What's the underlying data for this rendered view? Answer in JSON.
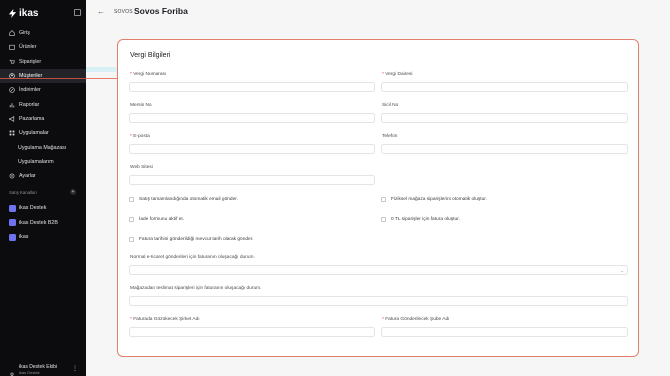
{
  "sidebar": {
    "brand": "ikas",
    "items": [
      {
        "label": "Giriş",
        "icon": "home-icon"
      },
      {
        "label": "Ürünler",
        "icon": "box-icon"
      },
      {
        "label": "Siparişler",
        "icon": "cart-icon"
      },
      {
        "label": "Müşteriler",
        "icon": "user-icon",
        "active": true
      },
      {
        "label": "İndirimler",
        "icon": "discount-icon"
      },
      {
        "label": "Raporlar",
        "icon": "chart-icon"
      },
      {
        "label": "Pazarlama",
        "icon": "megaphone-icon"
      },
      {
        "label": "Uygulamalar",
        "icon": "grid-icon"
      },
      {
        "label": "Uygulama Mağazası",
        "sub": true
      },
      {
        "label": "Uygulamalarım",
        "sub": true
      },
      {
        "label": "Ayarlar",
        "icon": "gear-icon"
      }
    ],
    "section_title": "Satış Kanalları",
    "channels": [
      {
        "label": "ikas Destek"
      },
      {
        "label": "ikas Destek B2B"
      },
      {
        "label": "ikas"
      }
    ],
    "user": {
      "name": "ikas Destek Ekibi",
      "sub": "ikas Destek"
    }
  },
  "header": {
    "breadcrumb": "SOVOS",
    "title": "Sovos Foriba"
  },
  "form": {
    "title": "Vergi Bilgileri",
    "tax_number_label": "Vergi Numarası",
    "tax_office_label": "Vergi Dairesi",
    "mersis_label": "Mersis No",
    "registry_label": "Sicil No",
    "email_label": "E-posta",
    "phone_label": "Telefon",
    "website_label": "Web Sitesi",
    "required_mark": "*",
    "checks": {
      "auto_email": "Satış tamamlandığında otomatik email gönder.",
      "physical_store": "Fiziksel mağaza siparişlerini otomatik oluştur.",
      "return_form": "İade formunu aktif et.",
      "zero_tl": "0 TL siparişler için fatura oluştur.",
      "current_date": "Fatura tarihini gönderildiği mevcut tarih olarak gönder."
    },
    "einvoice_status_label": "Normal e-ticaret gönderileri için faturanın oluşacağı durum.",
    "store_delivery_label": "Mağazadan teslimat siparişleri için faturanın oluşacağı durum.",
    "invoice_company_label": "Faturada Gözükecek Şirket Adı",
    "invoice_branch_label": "Fatura Gönderilecek Şube Adı"
  }
}
